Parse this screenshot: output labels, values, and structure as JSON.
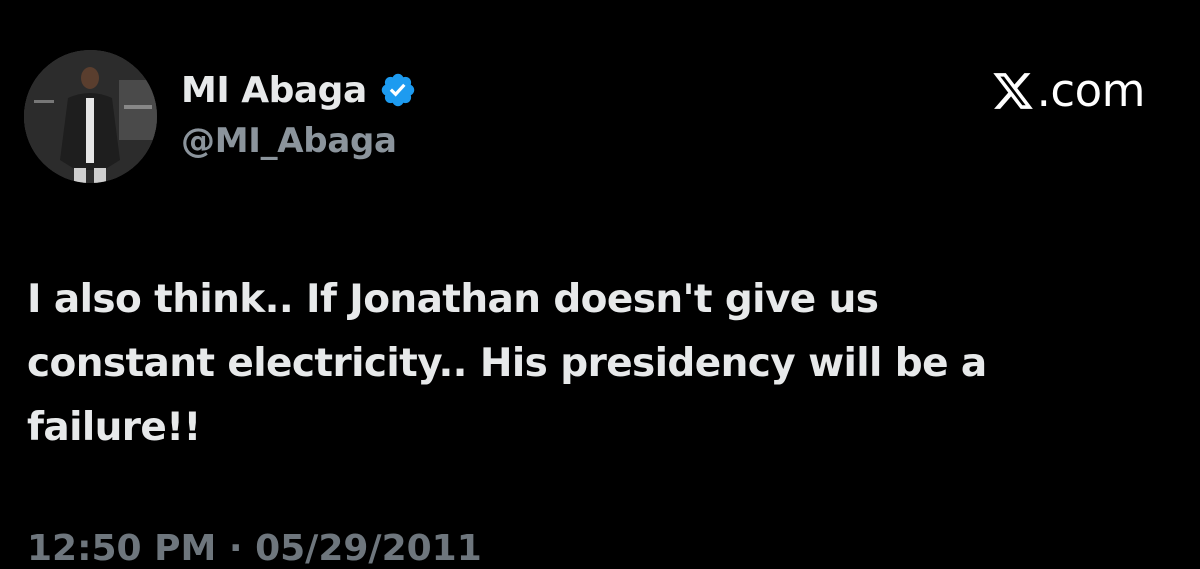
{
  "author": {
    "display_name": "MI Abaga",
    "handle": "@MI_Abaga",
    "verified": true,
    "avatar": "profile-photo"
  },
  "brand": {
    "logo_icon": "x-logo-icon",
    "text": ".com"
  },
  "tweet": {
    "text": "I also think.. If Jonathan doesn't give us\nconstant electricity.. His presidency will be a\nfailure!!",
    "timestamp": "12:50 PM · 05/29/2011"
  },
  "colors": {
    "background": "#000000",
    "text": "#e7e9ea",
    "secondary_text": "#8b949c",
    "verified_badge": "#1d9bf0"
  }
}
